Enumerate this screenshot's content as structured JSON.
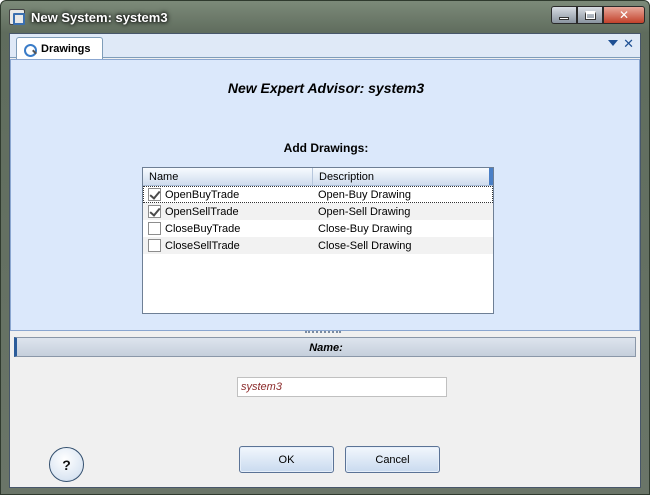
{
  "window": {
    "title": "New System: system3"
  },
  "tab": {
    "label": "Drawings"
  },
  "heading": "New Expert Advisor: system3",
  "subheading": "Add Drawings:",
  "list": {
    "columns": [
      "Name",
      "Description"
    ],
    "rows": [
      {
        "name": "OpenBuyTrade",
        "description": "Open-Buy Drawing",
        "checked": true
      },
      {
        "name": "OpenSellTrade",
        "description": "Open-Sell Drawing",
        "checked": true
      },
      {
        "name": "CloseBuyTrade",
        "description": "Close-Buy Drawing",
        "checked": false
      },
      {
        "name": "CloseSellTrade",
        "description": "Close-Sell Drawing",
        "checked": false
      }
    ]
  },
  "name_section": {
    "label": "Name:",
    "value": "system3"
  },
  "buttons": {
    "ok": "OK",
    "cancel": "Cancel",
    "help": "?"
  },
  "colors": {
    "accent": "#2b5c9a",
    "upper_panel": "#dbe8fb",
    "input_text": "#8b2a2a"
  }
}
